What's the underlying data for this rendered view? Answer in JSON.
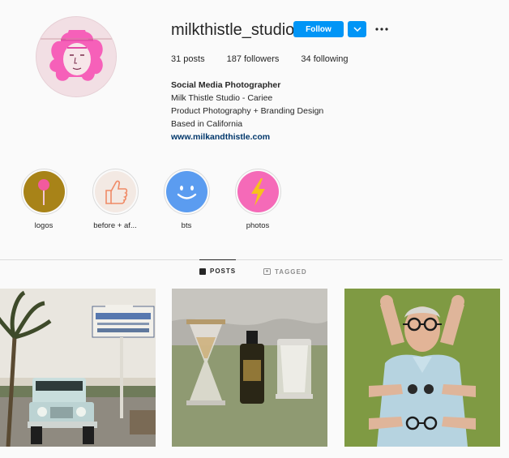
{
  "profile": {
    "username": "milkthistle_studio",
    "follow_label": "Follow",
    "stats": {
      "posts": "31 posts",
      "followers": "187 followers",
      "following": "34 following"
    },
    "bio": {
      "name": "Social Media Photographer",
      "line1": "Milk Thistle Studio - Cariee",
      "line2": "Product Photography + Branding Design",
      "line3": "Based in California",
      "link": "www.milkandthistle.com"
    }
  },
  "highlights": [
    {
      "label": "logos",
      "color": "#a88318"
    },
    {
      "label": "before + af...",
      "color": "#f3e9e3"
    },
    {
      "label": "bts",
      "color": "#5b9cf0"
    },
    {
      "label": "photos",
      "color": "#f56ab8"
    }
  ],
  "tabs": {
    "posts": "POSTS",
    "tagged": "TAGGED"
  },
  "colors": {
    "accent": "#0095f6",
    "link": "#00376b"
  }
}
